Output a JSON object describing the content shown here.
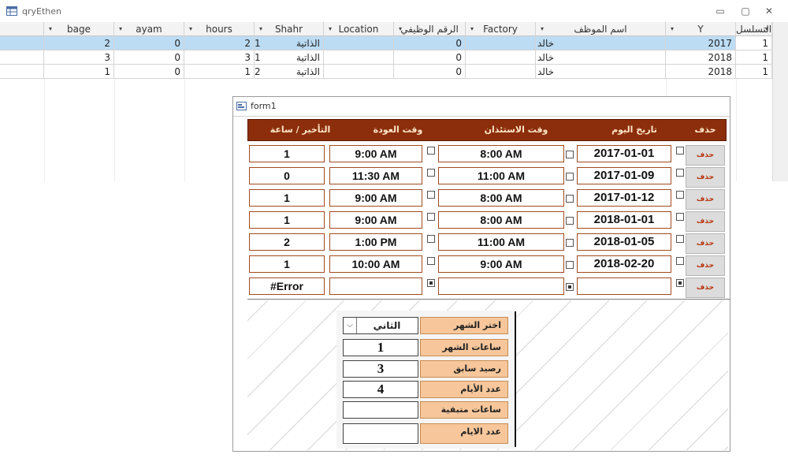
{
  "query_window": {
    "title": "qryEthen",
    "controls": {
      "minimize": "▭",
      "restore": "▢",
      "close": "✕"
    },
    "columns": [
      "التسلسل",
      "Y",
      "اسم الموظف",
      "Factory",
      "الرقم الوظيفي",
      "Location",
      "Shahr",
      "hours",
      "ayam",
      "bage"
    ],
    "rows": [
      {
        "seq": "1",
        "y": "2017",
        "emp": "خالد",
        "factory": "",
        "empno": "0",
        "location": "الذاتية",
        "shahr": "1",
        "hours": "2",
        "ayam": "0",
        "bage": "2"
      },
      {
        "seq": "1",
        "y": "2018",
        "emp": "خالد",
        "factory": "",
        "empno": "0",
        "location": "الذاتية",
        "shahr": "1",
        "hours": "3",
        "ayam": "0",
        "bage": "3"
      },
      {
        "seq": "1",
        "y": "2018",
        "emp": "خالد",
        "factory": "",
        "empno": "0",
        "location": "الذاتية",
        "shahr": "2",
        "hours": "1",
        "ayam": "0",
        "bage": "1"
      }
    ]
  },
  "form_window": {
    "title": "form1",
    "headers": {
      "delete": "حذف",
      "date": "تاريخ اليوم",
      "leave_time": "وقت الاستئذان",
      "return_time": "وقت العودة",
      "delay": "التأخير / ساعة"
    },
    "delete_label": "حذف",
    "rows": [
      {
        "date": "2017-01-01",
        "leave": "8:00 AM",
        "ret": "9:00 AM",
        "delay": "1"
      },
      {
        "date": "2017-01-09",
        "leave": "11:00 AM",
        "ret": "11:30 AM",
        "delay": "0"
      },
      {
        "date": "2017-01-12",
        "leave": "8:00 AM",
        "ret": "9:00 AM",
        "delay": "1"
      },
      {
        "date": "2018-01-01",
        "leave": "8:00 AM",
        "ret": "9:00 AM",
        "delay": "1"
      },
      {
        "date": "2018-01-05",
        "leave": "11:00 AM",
        "ret": "1:00 PM",
        "delay": "2"
      },
      {
        "date": "2018-02-20",
        "leave": "9:00 AM",
        "ret": "10:00 AM",
        "delay": "1"
      },
      {
        "date": "",
        "leave": "",
        "ret": "",
        "delay": "#Error"
      }
    ],
    "summary": {
      "month_label": "اختر الشهر",
      "month_value": "الثاني",
      "month_hours_label": "ساعات الشهر",
      "month_hours_value": "1",
      "prev_balance_label": "رصيد سابق",
      "prev_balance_value": "3",
      "days_count_label": "عدد الأيام",
      "days_count_value": "4",
      "remaining_hours_label": "ساعات متبقية",
      "remaining_hours_value": "",
      "days_label": "عدد الايام",
      "days_value": ""
    }
  }
}
